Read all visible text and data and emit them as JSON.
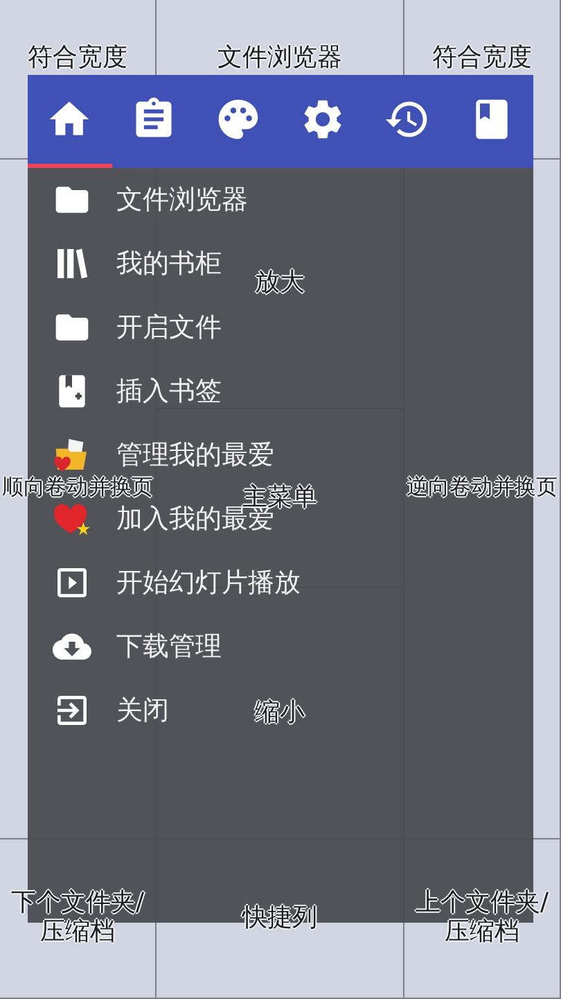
{
  "zones": {
    "top": [
      {
        "label": "符合宽度"
      },
      {
        "label": "文件浏览器"
      },
      {
        "label": "符合宽度"
      }
    ],
    "left": {
      "label": "顺向卷动并换页"
    },
    "middle": [
      {
        "label": "放大"
      },
      {
        "label": "主菜单"
      },
      {
        "label": "缩小"
      }
    ],
    "right": {
      "label": "逆向卷动并换页"
    },
    "bottom": [
      {
        "label": "下个文件夹/压缩档"
      },
      {
        "label": "快捷列"
      },
      {
        "label": "上个文件夹/压缩档"
      }
    ]
  },
  "menu": {
    "tabs": [
      {
        "selected": true
      },
      {
        "selected": false
      },
      {
        "selected": false
      },
      {
        "selected": false
      },
      {
        "selected": false
      },
      {
        "selected": false
      }
    ],
    "items": [
      {
        "label": "文件浏览器"
      },
      {
        "label": "我的书柜"
      },
      {
        "label": "开启文件"
      },
      {
        "label": "插入书签"
      },
      {
        "label": "管理我的最爱"
      },
      {
        "label": "加入我的最爱"
      },
      {
        "label": "开始幻灯片播放"
      },
      {
        "label": "下载管理"
      },
      {
        "label": "关闭"
      }
    ]
  }
}
